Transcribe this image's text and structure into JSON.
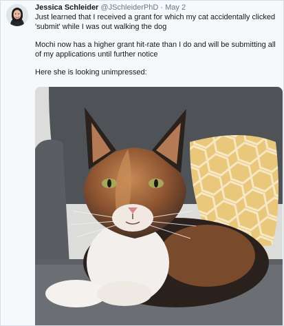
{
  "tweet": {
    "author_name": "Jessica Schleider",
    "author_handle": "@JSchleiderPhD",
    "separator": "·",
    "date": "May 2",
    "paragraphs": [
      "Just learned that I received a grant for which my cat accidentally clicked 'submit' while I was out walking the dog",
      "Mochi now has a higher grant hit-rate than I do and will be submitting all of my applications until further notice",
      "Here she is looking unimpressed:"
    ]
  },
  "avatar_icon": "profile-photo-icon",
  "media_icon": "cat-photo-icon"
}
